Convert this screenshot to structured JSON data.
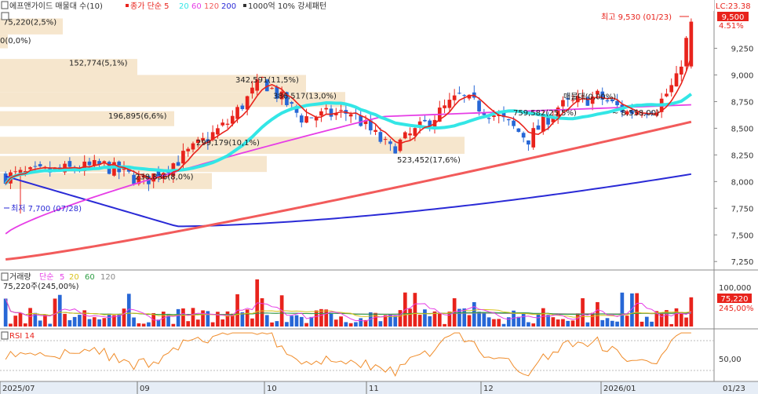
{
  "header": {
    "title": "에프앤가이드 매물대 수(10)",
    "close_ma": "종가 단순 5",
    "ma_periods": [
      "20",
      "60",
      "120",
      "200"
    ],
    "pattern": "1000억 10% 강세패턴",
    "lc": "LC:23.38"
  },
  "price_pane": {
    "high_label": "최고 9,530 (01/23)",
    "low_label": "최저 7,700 (07/28)",
    "last_price": "9,500",
    "last_change": "4.51%",
    "y_ticks": [
      "9,250",
      "9,000",
      "8,750",
      "8,500",
      "8,250",
      "8,000",
      "7,750",
      "7,500",
      "7,250"
    ],
    "volume_profile": [
      "75,220(2,5%)",
      "0(0,0%)",
      "152,774(5,1%)",
      "342,591(11,5%)",
      "386,517(13,0%)",
      "196,895(6,6%)",
      "299,179(10,1%)",
      "238,836(8,0%)",
      "523,452(17,6%)",
      "매물대(0,00%)",
      "759,582(25,5%)",
      "~ 8,558,00)"
    ]
  },
  "volume_pane": {
    "title": "거래량",
    "ma_label": "단순",
    "ma_periods": [
      "5",
      "20",
      "60",
      "120"
    ],
    "last_volume": "75,220주(245,00%)",
    "y_tick": "100,000",
    "last_value": "75,220",
    "last_pct": "245,00%"
  },
  "rsi_pane": {
    "title": "RSI 14",
    "y_tick": "50,00"
  },
  "x_axis": [
    "2025/07",
    "09",
    "10",
    "11",
    "12",
    "2026/01",
    "01/23"
  ],
  "colors": {
    "up": "#e8231c",
    "down": "#2767d6",
    "ma5": "#e8231c",
    "ma20": "#33e6e6",
    "ma60": "#e63ee6",
    "ma120": "#f25b5b",
    "ma200": "#2a2ad6",
    "rsi": "#f08c2a",
    "profile": "#f5e3c8"
  },
  "chart_data": {
    "type": "candlestick",
    "x": [
      "2025/07",
      "09",
      "10",
      "11",
      "12",
      "2026/01"
    ],
    "ylim": [
      7200,
      9600
    ],
    "high": 9530,
    "low": 7700,
    "last": 9500,
    "series": [
      {
        "name": "종가 단순 5"
      },
      {
        "name": "20"
      },
      {
        "name": "60"
      },
      {
        "name": "120"
      },
      {
        "name": "200"
      }
    ]
  }
}
